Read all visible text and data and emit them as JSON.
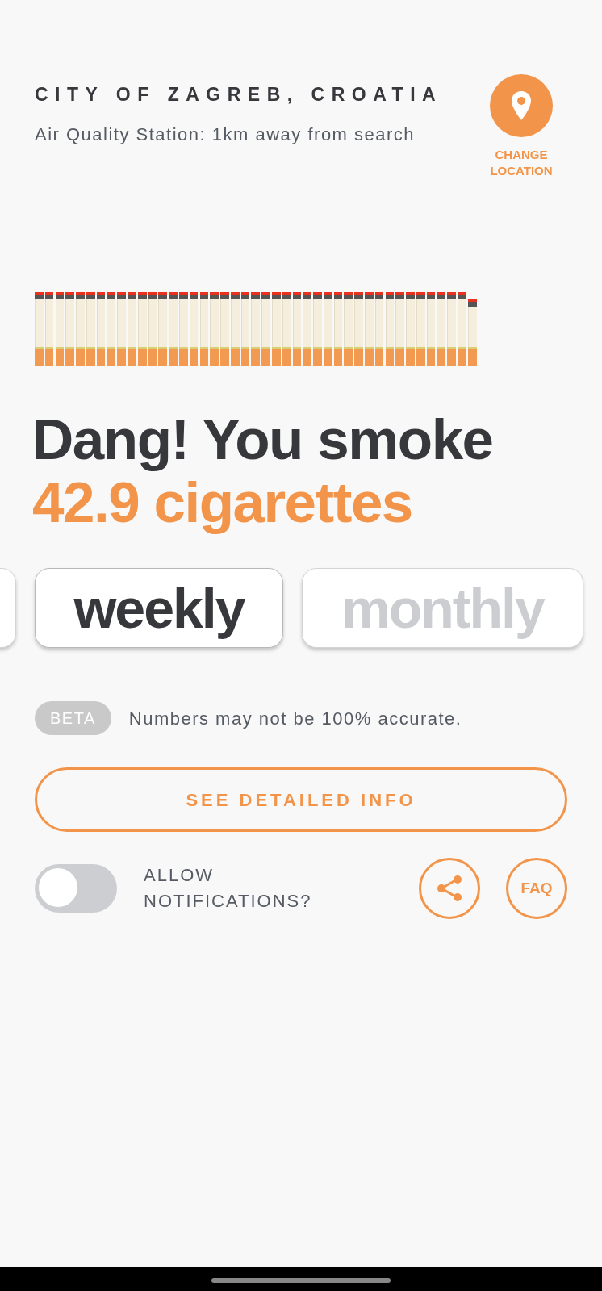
{
  "location": {
    "title": "CITY OF ZAGREB, CROATIA",
    "subtitle": "Air Quality Station: 1km away from search",
    "button_label": "CHANGE LOCATION"
  },
  "cigarettes": [
    {
      "kind": "whole"
    },
    {
      "kind": "whole"
    },
    {
      "kind": "whole"
    },
    {
      "kind": "whole"
    },
    {
      "kind": "whole"
    },
    {
      "kind": "whole"
    },
    {
      "kind": "whole"
    },
    {
      "kind": "whole"
    },
    {
      "kind": "whole"
    },
    {
      "kind": "whole"
    },
    {
      "kind": "whole"
    },
    {
      "kind": "whole"
    },
    {
      "kind": "whole"
    },
    {
      "kind": "whole"
    },
    {
      "kind": "whole"
    },
    {
      "kind": "whole"
    },
    {
      "kind": "whole"
    },
    {
      "kind": "whole"
    },
    {
      "kind": "whole"
    },
    {
      "kind": "whole"
    },
    {
      "kind": "whole"
    },
    {
      "kind": "whole"
    },
    {
      "kind": "whole"
    },
    {
      "kind": "whole"
    },
    {
      "kind": "whole"
    },
    {
      "kind": "whole"
    },
    {
      "kind": "whole"
    },
    {
      "kind": "whole"
    },
    {
      "kind": "whole"
    },
    {
      "kind": "whole"
    },
    {
      "kind": "whole"
    },
    {
      "kind": "whole"
    },
    {
      "kind": "whole"
    },
    {
      "kind": "whole"
    },
    {
      "kind": "whole"
    },
    {
      "kind": "whole"
    },
    {
      "kind": "whole"
    },
    {
      "kind": "whole"
    },
    {
      "kind": "whole"
    },
    {
      "kind": "whole"
    },
    {
      "kind": "whole"
    },
    {
      "kind": "whole"
    },
    {
      "kind": "partial"
    }
  ],
  "headline": {
    "text": "Dang! You smoke",
    "amount": "42.9 cigarettes"
  },
  "periods": [
    {
      "selected": false
    },
    {
      "label": "weekly",
      "selected": true
    },
    {
      "label": "monthly",
      "selected": false
    }
  ],
  "beta": {
    "badge": "BETA",
    "note": "Numbers may not be 100% accurate."
  },
  "detail_button": "SEE DETAILED INFO",
  "notifications": {
    "label": "ALLOW NOTIFICATIONS?",
    "on": false
  },
  "faq_button": "FAQ"
}
